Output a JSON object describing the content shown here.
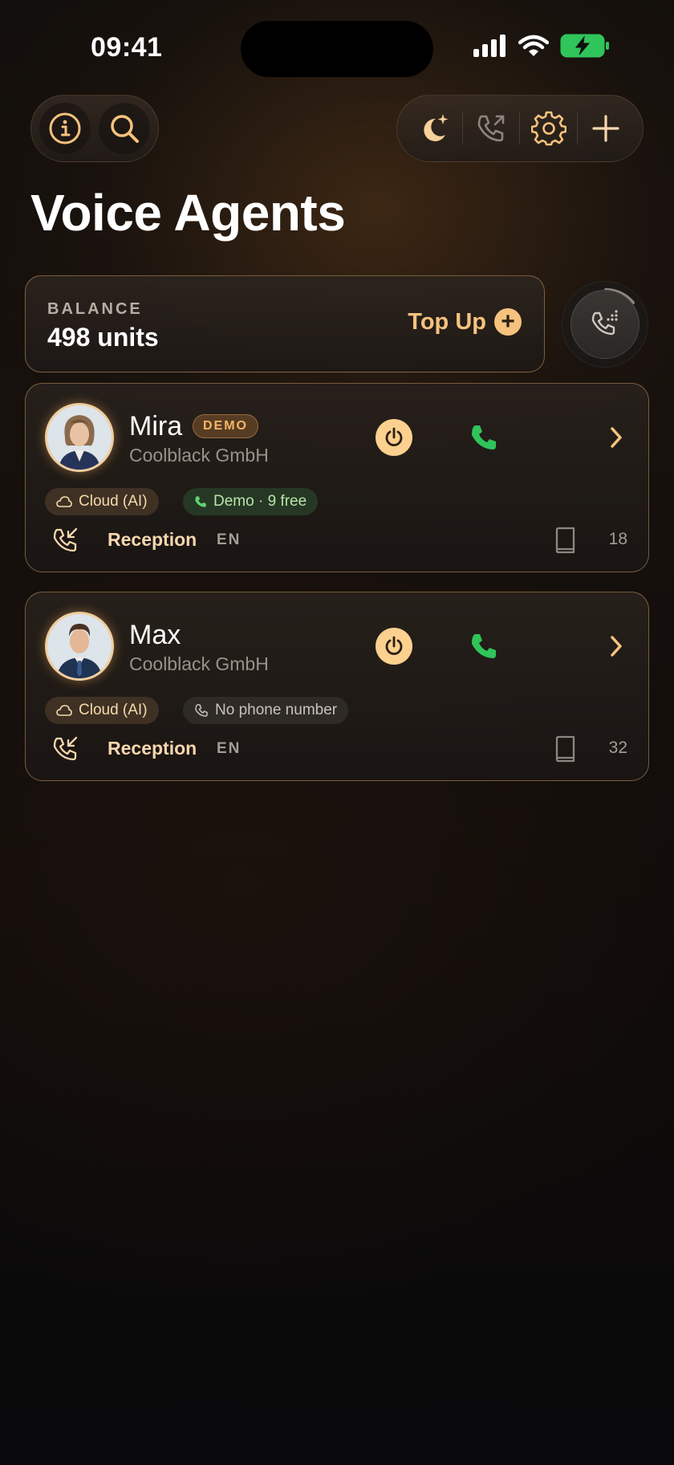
{
  "status": {
    "time": "09:41"
  },
  "header": {
    "title": "Voice Agents",
    "left_buttons": [
      "info-icon",
      "search-icon"
    ],
    "right_buttons": [
      "moon-sparkle-icon",
      "phone-outgoing-icon",
      "gear-icon",
      "plus-icon"
    ]
  },
  "balance": {
    "label": "BALANCE",
    "value": "498 units",
    "topup_label": "Top Up",
    "topup_icon": "+"
  },
  "agents": [
    {
      "name": "Mira",
      "badge": "DEMO",
      "company": "Coolblack GmbH",
      "chips": {
        "cloud": "Cloud (AI)",
        "phone": "Demo · 9 free"
      },
      "route": "Reception",
      "lang": "EN",
      "count": "18"
    },
    {
      "name": "Max",
      "company": "Coolblack GmbH",
      "chips": {
        "cloud": "Cloud (AI)",
        "phone": "No phone number"
      },
      "route": "Reception",
      "lang": "EN",
      "count": "32"
    }
  ],
  "colors": {
    "accent": "#f6c27e",
    "call_green": "#2fc55a",
    "card_border": "#b0885a"
  }
}
